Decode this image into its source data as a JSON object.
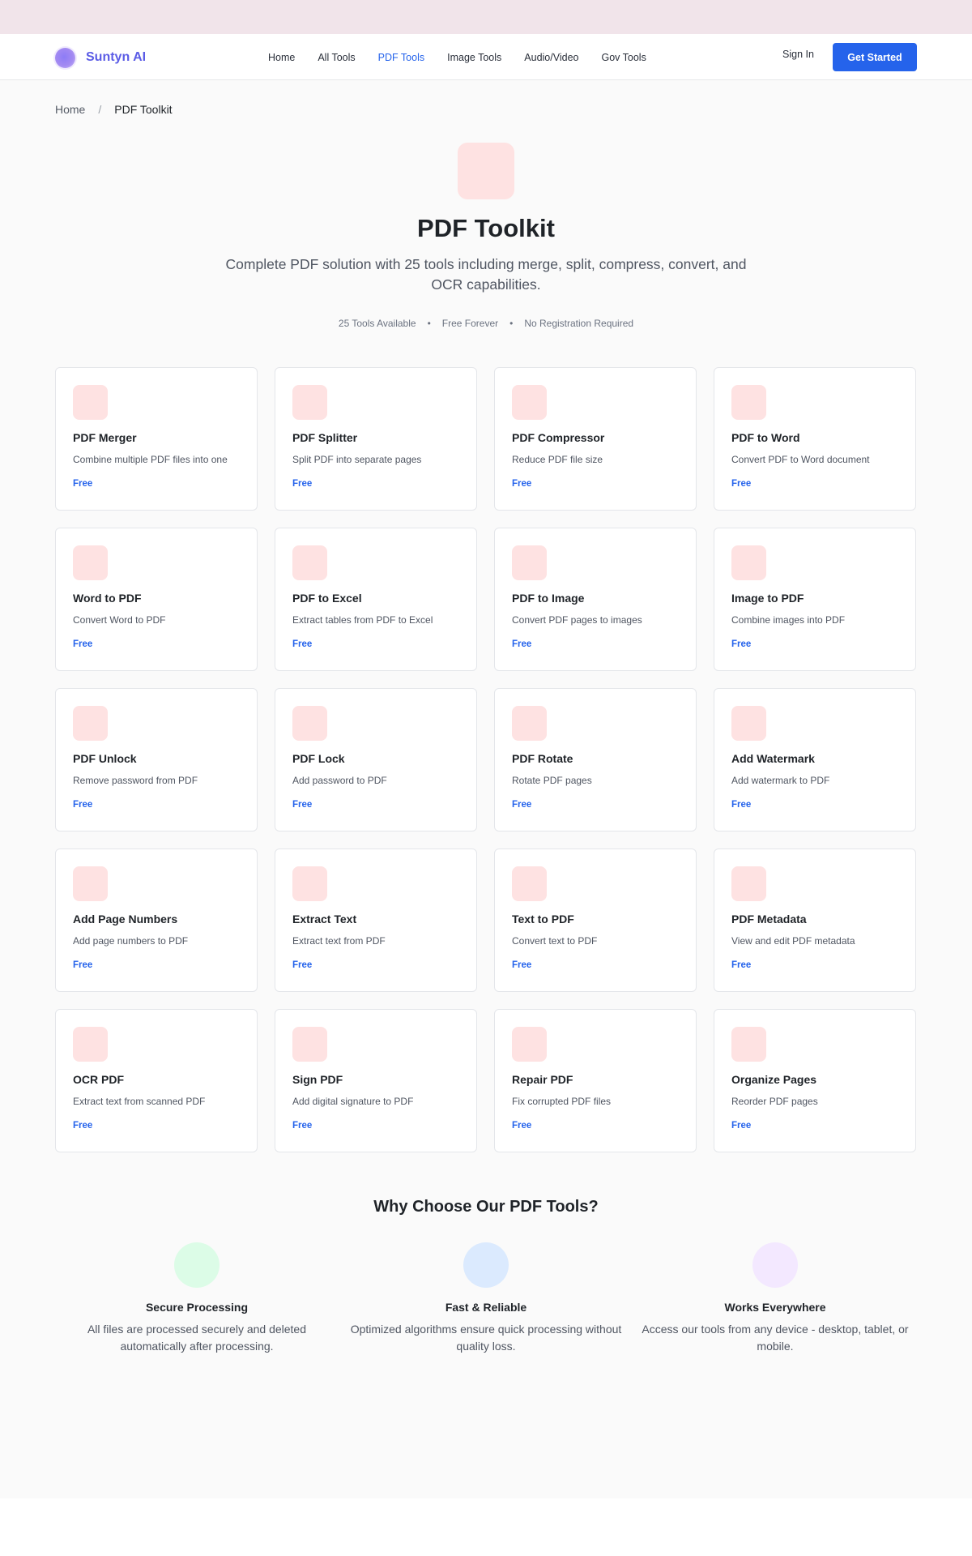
{
  "brand": {
    "name": "Suntyn AI",
    "accent": "#5b5ce6"
  },
  "nav": {
    "links": [
      "Home",
      "All Tools",
      "PDF Tools",
      "Image Tools",
      "Audio/Video",
      "Gov Tools"
    ],
    "active": "PDF Tools",
    "sign_in": "Sign In",
    "get_started": "Get Started",
    "primary_color": "#2563eb"
  },
  "breadcrumb": {
    "home": "Home",
    "separator": "/",
    "current": "PDF Toolkit"
  },
  "hero": {
    "icon": "pdf-icon",
    "title": "PDF Toolkit",
    "description": "Complete PDF solution with 25 tools including merge, split, compress, convert, and OCR capabilities.",
    "meta": [
      "25 Tools Available",
      "Free Forever",
      "No Registration Required"
    ],
    "meta_separator": "•"
  },
  "tools": [
    {
      "title": "PDF Merger",
      "desc": "Combine multiple PDF files into one",
      "badge": "Free"
    },
    {
      "title": "PDF Splitter",
      "desc": "Split PDF into separate pages",
      "badge": "Free"
    },
    {
      "title": "PDF Compressor",
      "desc": "Reduce PDF file size",
      "badge": "Free"
    },
    {
      "title": "PDF to Word",
      "desc": "Convert PDF to Word document",
      "badge": "Free"
    },
    {
      "title": "Word to PDF",
      "desc": "Convert Word to PDF",
      "badge": "Free"
    },
    {
      "title": "PDF to Excel",
      "desc": "Extract tables from PDF to Excel",
      "badge": "Free"
    },
    {
      "title": "PDF to Image",
      "desc": "Convert PDF pages to images",
      "badge": "Free"
    },
    {
      "title": "Image to PDF",
      "desc": "Combine images into PDF",
      "badge": "Free"
    },
    {
      "title": "PDF Unlock",
      "desc": "Remove password from PDF",
      "badge": "Free"
    },
    {
      "title": "PDF Lock",
      "desc": "Add password to PDF",
      "badge": "Free"
    },
    {
      "title": "PDF Rotate",
      "desc": "Rotate PDF pages",
      "badge": "Free"
    },
    {
      "title": "Add Watermark",
      "desc": "Add watermark to PDF",
      "badge": "Free"
    },
    {
      "title": "Add Page Numbers",
      "desc": "Add page numbers to PDF",
      "badge": "Free"
    },
    {
      "title": "Extract Text",
      "desc": "Extract text from PDF",
      "badge": "Free"
    },
    {
      "title": "Text to PDF",
      "desc": "Convert text to PDF",
      "badge": "Free"
    },
    {
      "title": "PDF Metadata",
      "desc": "View and edit PDF metadata",
      "badge": "Free"
    },
    {
      "title": "OCR PDF",
      "desc": "Extract text from scanned PDF",
      "badge": "Free"
    },
    {
      "title": "Sign PDF",
      "desc": "Add digital signature to PDF",
      "badge": "Free"
    },
    {
      "title": "Repair PDF",
      "desc": "Fix corrupted PDF files",
      "badge": "Free"
    },
    {
      "title": "Organize Pages",
      "desc": "Reorder PDF pages",
      "badge": "Free"
    }
  ],
  "why": {
    "title": "Why Choose Our PDF Tools?",
    "features": [
      {
        "title": "Secure Processing",
        "desc": "All files are processed securely and deleted automatically after processing.",
        "color": "#dcfce7",
        "icon": "shield-icon"
      },
      {
        "title": "Fast & Reliable",
        "desc": "Optimized algorithms ensure quick processing without quality loss.",
        "color": "#dbeafe",
        "icon": "lightning-icon"
      },
      {
        "title": "Works Everywhere",
        "desc": "Access our tools from any device - desktop, tablet, or mobile.",
        "color": "#f3e8ff",
        "icon": "devices-icon"
      }
    ]
  }
}
